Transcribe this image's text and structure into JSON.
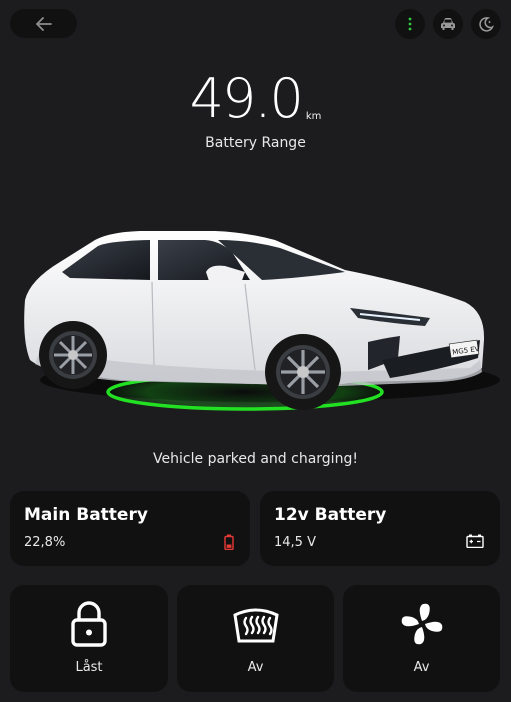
{
  "header": {
    "back_icon": "arrow-left-icon",
    "buttons": [
      {
        "name": "more-options-button",
        "icon": "vertical-dots-icon",
        "color": "#2ecc40"
      },
      {
        "name": "vehicle-button",
        "icon": "car-icon"
      },
      {
        "name": "night-mode-button",
        "icon": "moon-icon"
      }
    ]
  },
  "range": {
    "value": "49.0",
    "unit": "km",
    "label": "Battery Range"
  },
  "vehicle": {
    "status": "Vehicle parked and charging!",
    "plate": "MG5 EV",
    "charging_glow_color": "#22e022"
  },
  "batteries": [
    {
      "title": "Main Battery",
      "value": "22,8%",
      "icon": "battery-low-icon",
      "icon_color": "#e53935",
      "level_percent": 22.8
    },
    {
      "title": "12v Battery",
      "value": "14,5 V",
      "icon": "car-battery-icon",
      "icon_color": "#ffffff"
    }
  ],
  "controls": [
    {
      "label": "Låst",
      "icon": "lock-icon"
    },
    {
      "label": "Av",
      "icon": "rear-defrost-icon"
    },
    {
      "label": "Av",
      "icon": "fan-icon"
    }
  ],
  "colors": {
    "background": "#1c1c1e",
    "card": "#111112",
    "accent_green": "#2ecc40",
    "alert_red": "#e53935"
  }
}
